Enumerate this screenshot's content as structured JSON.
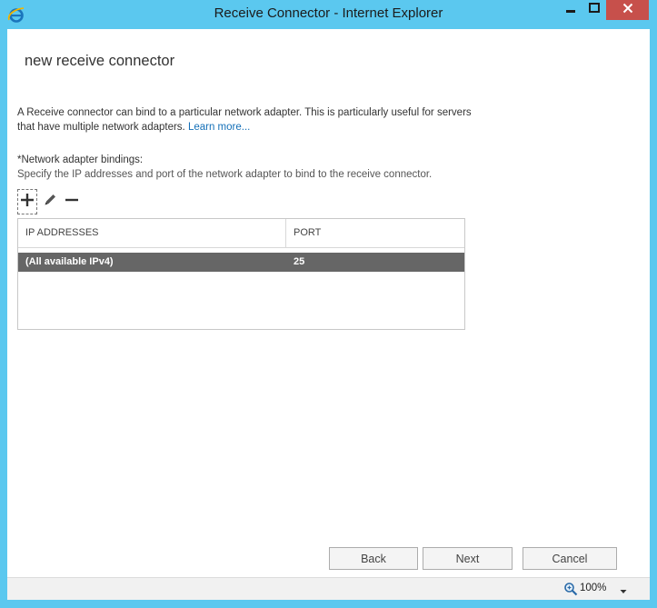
{
  "window": {
    "title": "Receive Connector - Internet Explorer",
    "icons": {
      "app": "ie-icon",
      "minimize": "minimize-icon",
      "maximize": "maximize-icon",
      "close": "close-icon"
    }
  },
  "page": {
    "title": "new receive connector",
    "description": "A Receive connector can bind to a particular network adapter. This is particularly useful for servers that have multiple network adapters.",
    "learn_more": "Learn more...",
    "bindings_label": "*Network adapter bindings:",
    "bindings_help": "Specify the IP addresses and port of the network adapter to bind to the receive connector."
  },
  "toolbar": {
    "add_icon": "plus-icon",
    "edit_icon": "pencil-icon",
    "remove_icon": "minus-icon"
  },
  "grid": {
    "columns": [
      "IP ADDRESSES",
      "PORT"
    ],
    "rows": [
      {
        "ip": "(All available IPv4)",
        "port": "25",
        "selected": true
      }
    ]
  },
  "buttons": {
    "back": "Back",
    "next": "Next",
    "cancel": "Cancel"
  },
  "status": {
    "zoom": "100%"
  },
  "colors": {
    "frame": "#5bc8ef",
    "close": "#c7504b",
    "selected_row": "#666666",
    "link": "#1570b8"
  }
}
